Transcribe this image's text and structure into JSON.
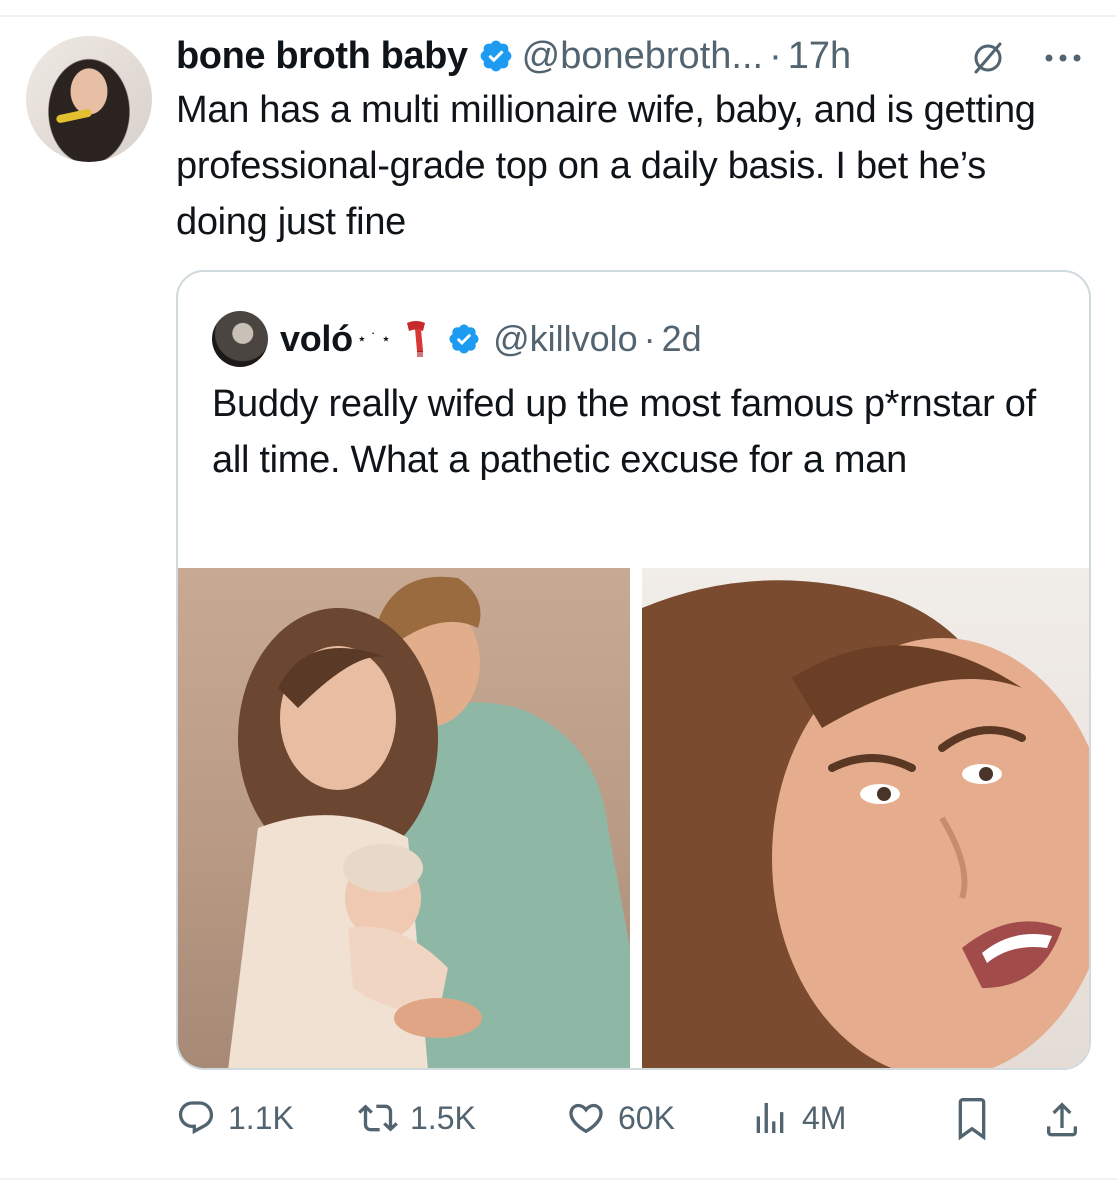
{
  "author": {
    "name": "bone broth baby",
    "handle": "@bonebroth...",
    "separator": "·",
    "time": "17h",
    "avatar_icon": "profile-photo"
  },
  "tweet": {
    "text": "Man has a multi millionaire wife, baby, and is getting professional-grade top on a daily basis. I bet he’s doing just fine"
  },
  "quote": {
    "name": "voló",
    "decor": "⋆ ˙ ⋆",
    "emoji": "scarf-icon",
    "handle": "@killvolo",
    "separator": "·",
    "time": "2d",
    "text": "Buddy really wifed up the most famous p*rnstar of all time. What a pathetic excuse for a man"
  },
  "actions": {
    "replies": "1.1K",
    "reposts": "1.5K",
    "likes": "60K",
    "views": "4M"
  },
  "colors": {
    "text": "#0f1419",
    "muted": "#536471",
    "verified": "#1d9bf0",
    "border": "#cfd9de"
  }
}
